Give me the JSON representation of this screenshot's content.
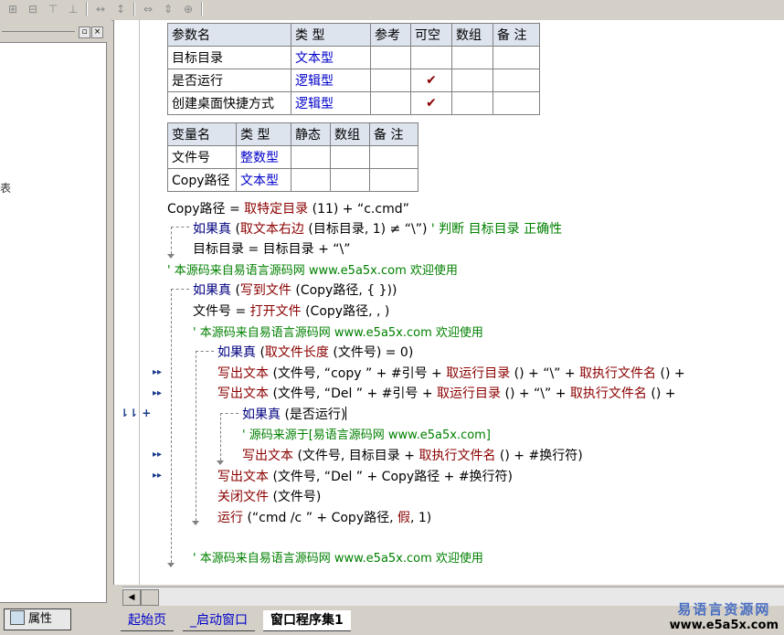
{
  "left_panel": {
    "fragment": "表",
    "property_tab_label": "属性"
  },
  "param_table": {
    "headers": [
      "参数名",
      "类 型",
      "参考",
      "可空",
      "数组",
      "备 注"
    ],
    "rows": [
      {
        "name": "目标目录",
        "type": "文本型",
        "optional": ""
      },
      {
        "name": "是否运行",
        "type": "逻辑型",
        "optional": "✔"
      },
      {
        "name": "创建桌面快捷方式",
        "type": "逻辑型",
        "optional": "✔"
      }
    ]
  },
  "var_table": {
    "headers": [
      "变量名",
      "类 型",
      "静态",
      "数组",
      "备 注"
    ],
    "rows": [
      {
        "name": "文件号",
        "type": "整数型"
      },
      {
        "name": "Copy路径",
        "type": "文本型"
      }
    ]
  },
  "code": {
    "l1a": "Copy路径 = ",
    "l1b": "取特定目录",
    "l1c": " (11) + “c.cmd”",
    "l2a": "如果真",
    "l2b": " (",
    "l2c": "取文本右边",
    "l2d": " (目标目录, 1) ≠ “\\”)",
    "l2e": " ' 判断 目标目录 正确性",
    "l3": "目标目录 = 目标目录 + “\\”",
    "l4": "' 本源码来自易语言源码网 www.e5a5x.com  欢迎使用",
    "l5a": "如果真",
    "l5b": " (",
    "l5c": "写到文件",
    "l5d": " (Copy路径, { }))",
    "l6a": "文件号 = ",
    "l6b": "打开文件",
    "l6c": " (Copy路径, , )",
    "l7": "' 本源码来自易语言源码网 www.e5a5x.com  欢迎使用",
    "l8a": "如果真",
    "l8b": " (",
    "l8c": "取文件长度",
    "l8d": " (文件号) = 0)",
    "l9a": "写出文本",
    "l9b": " (文件号, “copy ” + #引号 + ",
    "l9c": "取运行目录",
    "l9d": " () + “\\” + ",
    "l9e": "取执行文件名",
    "l9f": " () +",
    "l10a": "写出文本",
    "l10b": " (文件号, “Del ” + #引号 + ",
    "l10c": "取运行目录",
    "l10d": " () + “\\” + ",
    "l10e": "取执行文件名",
    "l10f": " () +",
    "l11a": "如果真",
    "l11b": " (是否运行)",
    "l12": "' 源码来源于[易语言源码网 www.e5a5x.com]",
    "l13a": "写出文本",
    "l13b": " (文件号, 目标目录 + ",
    "l13c": "取执行文件名",
    "l13d": " () + #换行符)",
    "l14a": "写出文本",
    "l14b": " (文件号, “Del ” + Copy路径 + #换行符)",
    "l15a": "关闭文件",
    "l15b": " (文件号)",
    "l16a": "运行",
    "l16b": " (“cmd /c ” + Copy路径, ",
    "l16c": "假",
    "l16d": ", 1)",
    "l17": "' 本源码来自易语言源码网 www.e5a5x.com  欢迎使用"
  },
  "tabs": [
    "起始页",
    "_启动窗口",
    "窗口程序集1"
  ],
  "brand": {
    "name": "易语言资源网",
    "url": "www.e5a5x.com"
  }
}
